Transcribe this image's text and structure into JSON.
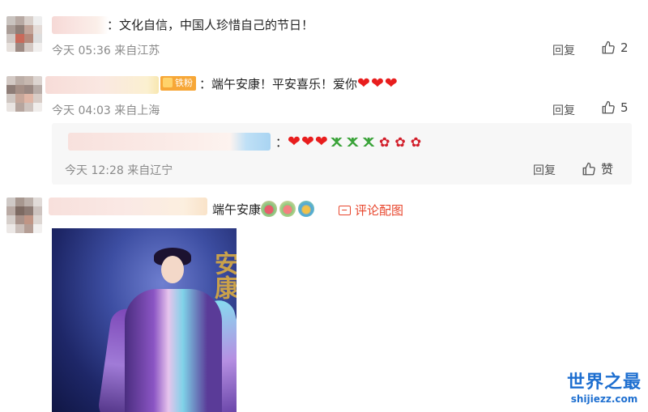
{
  "comments": [
    {
      "text": "：文化自信，中国人珍惜自己的节日！",
      "time": "今天 05:36 来自江苏",
      "reply_label": "回复",
      "like_count": "2"
    },
    {
      "badge": "铁粉",
      "text": "：端午安康！平安喜乐！爱你",
      "hearts": [
        "❤",
        "❤",
        "❤"
      ],
      "time": "今天 04:03 来自上海",
      "reply_label": "回复",
      "like_count": "5",
      "sub_reply": {
        "time": "今天 12:28 来自辽宁",
        "reply_label": "回复",
        "like_label": "赞",
        "hearts": [
          "❤",
          "❤",
          "❤"
        ],
        "ribbons": [
          "ⵅ",
          "ⵅ",
          "ⵅ"
        ],
        "roses": [
          "✿",
          "✿",
          "✿"
        ]
      }
    },
    {
      "text": "端午安康",
      "image_link_label": "评论配图",
      "poster_title": "安康"
    }
  ],
  "watermark": {
    "title": "世界之最",
    "url": "shijiezz.com"
  },
  "colors": {
    "link": "#e8462d",
    "heart": "#e81d1d",
    "ribbon": "#3aa339",
    "rose": "#d21e2a",
    "watermark": "#1e6fd0"
  },
  "icons": [
    "thumbs-up-icon",
    "image-icon",
    "heart-emoji",
    "ribbon-emoji",
    "rose-emoji",
    "zongzi-emoji"
  ]
}
